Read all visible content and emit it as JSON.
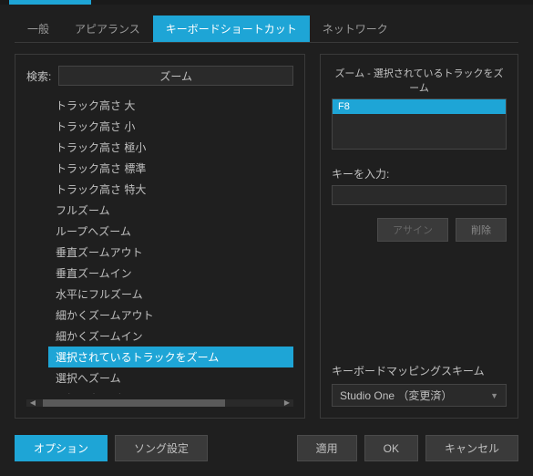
{
  "tabs": {
    "general": "一般",
    "appearance": "アピアランス",
    "shortcuts": "キーボードショートカット",
    "network": "ネットワーク"
  },
  "search": {
    "label": "検索:",
    "value": "ズーム"
  },
  "commands": [
    "トラック高さ 大",
    "トラック高さ 小",
    "トラック高さ 極小",
    "トラック高さ 標準",
    "トラック高さ 特大",
    "フルズーム",
    "ループへズーム",
    "垂直ズームアウト",
    "垂直ズームイン",
    "水平にフルズーム",
    "細かくズームアウト",
    "細かくズームイン",
    "選択されているトラックをズーム",
    "選択へズーム",
    "選択へ水平ズーム"
  ],
  "selectedIndex": 12,
  "right": {
    "title": "ズーム - 選択されているトラックをズーム",
    "assigned_key": "F8",
    "key_label": "キーを入力:",
    "assign_btn": "アサイン",
    "delete_btn": "削除",
    "scheme_label": "キーボードマッピングスキーム",
    "scheme_value": "Studio One （変更済）"
  },
  "footer": {
    "options": "オプション",
    "song_setup": "ソング設定",
    "apply": "適用",
    "ok": "OK",
    "cancel": "キャンセル"
  }
}
